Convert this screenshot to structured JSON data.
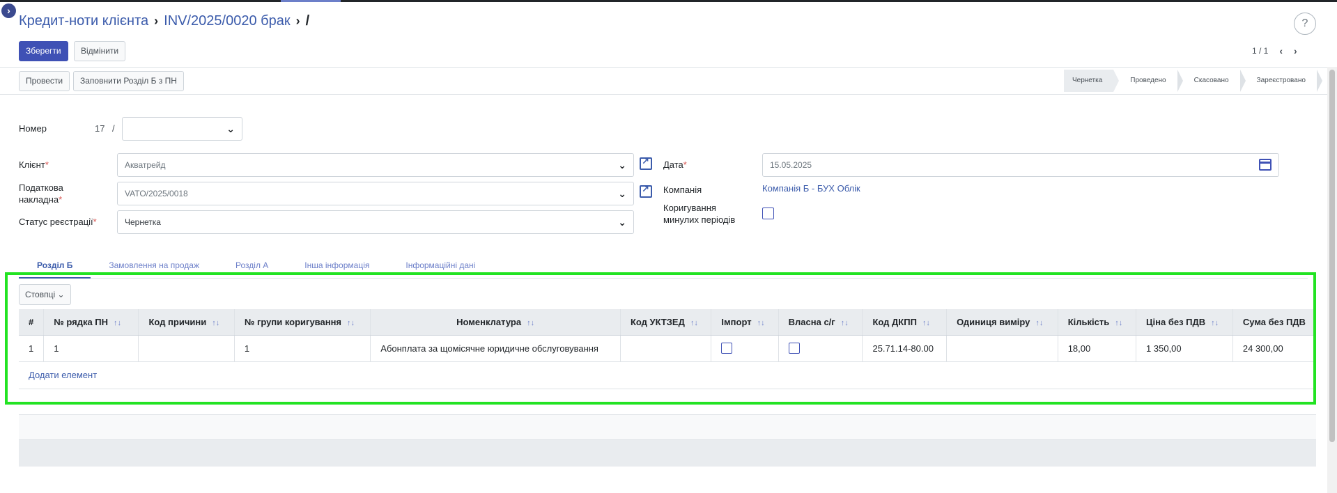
{
  "breadcrumb": {
    "root": "Кредит-ноти клієнта",
    "record": "INV/2025/0020 брак",
    "current": "/"
  },
  "actions": {
    "save": "Зберегти",
    "discard": "Відмінити"
  },
  "pager": {
    "value": "1 / 1",
    "prev": "‹",
    "next": "›"
  },
  "help": "?",
  "toolbar": {
    "post": "Провести",
    "fill": "Заповнити Розділ Б з ПН"
  },
  "status": {
    "stages": [
      "Чернетка",
      "Проведено",
      "Скасовано",
      "Зареєстровано"
    ],
    "active": "Чернетка"
  },
  "form": {
    "number": {
      "label": "Номер",
      "prefix": "17",
      "slash": "/",
      "value": ""
    },
    "client": {
      "label": "Клієнт",
      "value": "Акватрейд"
    },
    "tax_invoice": {
      "label": "Податкова накладна",
      "value": "VATO/2025/0018"
    },
    "reg_status": {
      "label": "Статус реєстрації",
      "value": "Чернетка"
    },
    "date": {
      "label": "Дата",
      "value": "15.05.2025"
    },
    "company": {
      "label": "Компанія",
      "value": "Компанія Б - БУХ Облік"
    },
    "past_correction": {
      "label": "Коригування минулих періодів",
      "checked": false
    },
    "required_mark": "*"
  },
  "tabs": [
    "Розділ Б",
    "Замовлення на продаж",
    "Розділ А",
    "Інша інформація",
    "Інформаційні дані"
  ],
  "active_tab": "Розділ Б",
  "columns_button": "Стовпці",
  "table": {
    "headers": [
      "#",
      "№ рядка ПН",
      "Код причини",
      "№ групи коригування",
      "Номенклатура",
      "Код УКТЗЕД",
      "Імпорт",
      "Власна с/г",
      "Код ДКПП",
      "Одиниця виміру",
      "Кількість",
      "Ціна без ПДВ",
      "Сума без ПДВ"
    ],
    "rows": [
      {
        "num": "1",
        "pn_row": "1",
        "reason": "",
        "group": "1",
        "item": "Абонплата за щомісячне юридичне обслуговування",
        "uktzed": "",
        "import": false,
        "own_ag": false,
        "dkpp": "25.71.14-80.00",
        "unit": "",
        "qty": "18,00",
        "price": "1 350,00",
        "sum": "24 300,00"
      }
    ],
    "add_line": "Додати елемент"
  },
  "colors": {
    "accent": "#3f51b5",
    "link": "#3b5bab",
    "highlight": "#22e322"
  }
}
